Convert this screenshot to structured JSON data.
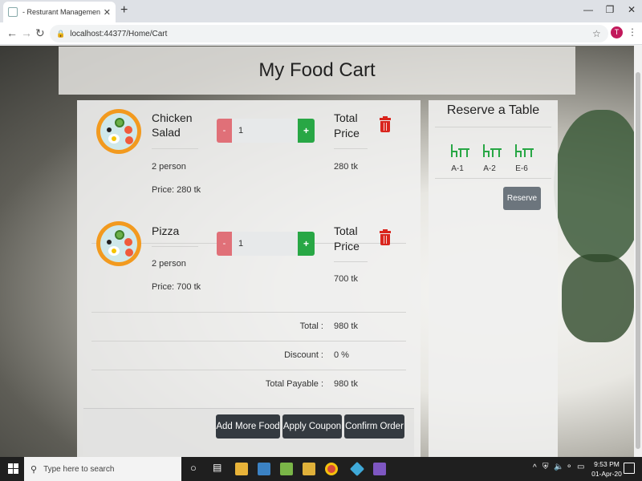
{
  "browser": {
    "tab_title": "- Resturant Management System",
    "tab_close": "✕",
    "new_tab": "+",
    "url": "localhost:44377/Home/Cart",
    "back_icon": "←",
    "forward_icon": "→",
    "reload_icon": "↻",
    "lock_icon": "🔒",
    "star_icon": "☆",
    "profile_initial": "T",
    "menu_icon": "⋮",
    "minimize": "—",
    "maximize": "❐",
    "close": "✕"
  },
  "page": {
    "title": "My Food Cart"
  },
  "cart": {
    "items": [
      {
        "name": "Chicken Salad",
        "serving": "2 person",
        "price": "Price: 280 tk",
        "quantity": "1",
        "minus_label": "-",
        "plus_label": "+",
        "total_label": "Total Price",
        "total_value": "280 tk"
      },
      {
        "name": "Pizza",
        "serving": "2 person",
        "price": "Price: 700 tk",
        "quantity": "1",
        "minus_label": "-",
        "plus_label": "+",
        "total_label": "Total Price",
        "total_value": "700 tk"
      }
    ],
    "summary": {
      "total_label": "Total :",
      "total_value": "980 tk",
      "discount_label": "Discount :",
      "discount_value": "0 %",
      "payable_label": "Total Payable :",
      "payable_value": "980 tk"
    },
    "buttons": {
      "add_more": "Add More Food",
      "apply_coupon": "Apply Coupon",
      "confirm_order": "Confirm Order"
    }
  },
  "reserve": {
    "title": "Reserve a Table",
    "tables": [
      "A-1",
      "A-2",
      "E-6"
    ],
    "button": "Reserve",
    "accent_color": "#28a745"
  },
  "taskbar": {
    "search_placeholder": "Type here to search",
    "time": "9:53 PM",
    "date": "01-Apr-20"
  }
}
